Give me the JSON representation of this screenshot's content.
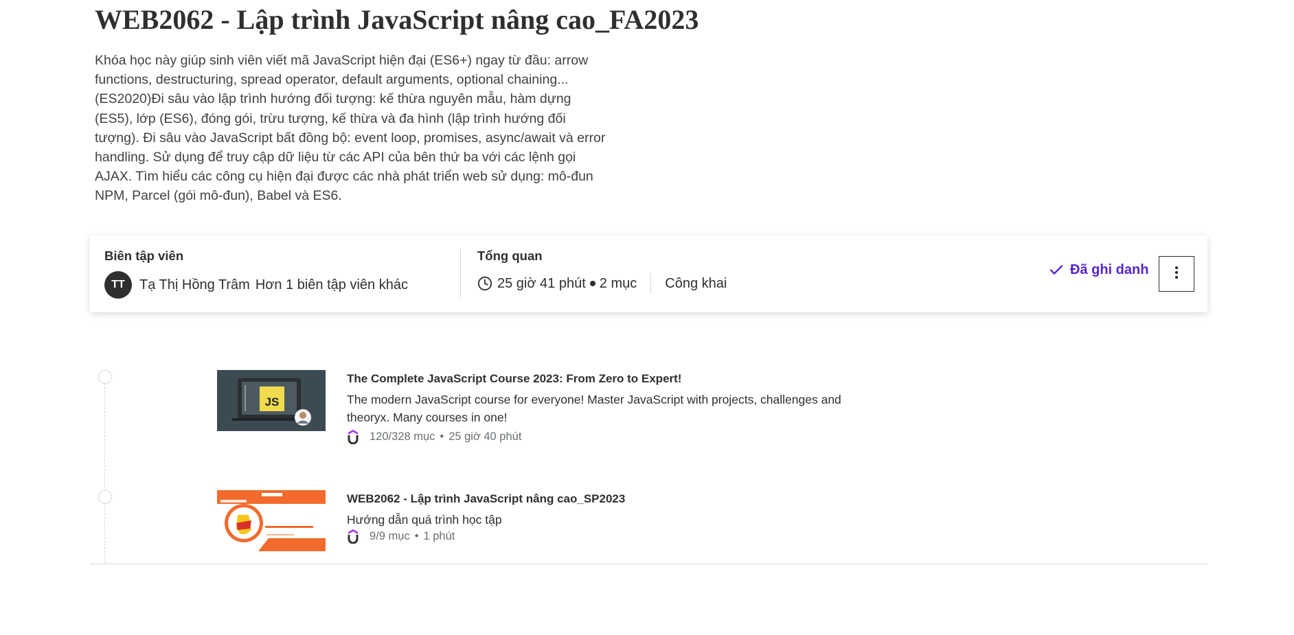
{
  "page": {
    "title": "WEB2062 - Lập trình JavaScript nâng cao_FA2023",
    "description": "Khóa học này giúp sinh viên viết mã JavaScript hiện đại (ES6+) ngay từ đầu: arrow functions, destructuring, spread operator, default arguments, optional chaining...(ES2020)Đi sâu vào lập trình hướng đối tượng: kế thừa nguyên mẫu, hàm dựng (ES5), lớp (ES6), đóng gói, trừu tượng, kế thừa và đa hình (lập trình hướng đối tượng). Đi sâu vào JavaScript bất đồng bộ: event loop, promises, async/await và error handling. Sử dụng để truy cập dữ liệu từ các API của bên thứ ba với các lệnh gọi AJAX. Tìm hiểu các công cụ hiện đại được các nhà phát triển web sử dụng: mô-đun NPM, Parcel (gói mô-đun), Babel và ES6."
  },
  "info_card": {
    "editor_heading": "Biên tập viên",
    "editor_initials": "TT",
    "editor_name": "Tạ Thị Hồng Trâm",
    "editor_more": "Hơn 1 biên tập viên khác",
    "overview_heading": "Tổng quan",
    "duration": "25 giờ 41 phút",
    "items": "2 mục",
    "visibility": "Công khai",
    "enrolled_label": "Đã ghi danh"
  },
  "icons": {
    "clock": "clock-icon",
    "check": "check-icon",
    "more": "more-vertical-icon",
    "udemy": "udemy-logo-icon"
  },
  "colors": {
    "accent": "#5624d0",
    "text": "#2d2f31",
    "muted": "#6a6f73"
  },
  "courses": [
    {
      "title": "The Complete JavaScript Course 2023: From Zero to Expert!",
      "description": "The modern JavaScript course for everyone! Master JavaScript with projects, challenges and theoryx. Many courses in one!",
      "progress": "120/328 mục",
      "duration": "25 giờ 40 phút",
      "thumb_label": "JS"
    },
    {
      "title": "WEB2062 - Lập trình JavaScript nâng cao_SP2023",
      "description": "Hướng dẫn quá trình học tập",
      "progress": "9/9 mục",
      "duration": "1 phút"
    }
  ]
}
